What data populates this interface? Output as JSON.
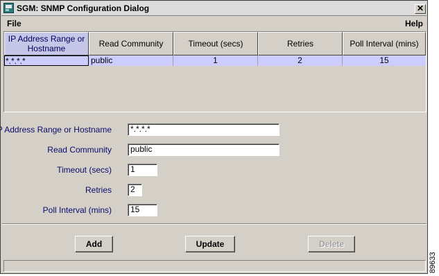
{
  "window": {
    "title": "SGM: SNMP Configuration Dialog",
    "close_glyph": "✕"
  },
  "menu": {
    "file": "File",
    "help": "Help"
  },
  "table": {
    "headers": [
      "IP Address Range or Hostname",
      "Read Community",
      "Timeout (secs)",
      "Retries",
      "Poll Interval (mins)"
    ],
    "rows": [
      {
        "ip": "*.*.*.*",
        "community": "public",
        "timeout": "1",
        "retries": "2",
        "poll": "15"
      }
    ]
  },
  "form": {
    "ip_label": "IP Address Range or Hostname",
    "ip_value": "*.*.*.*",
    "community_label": "Read Community",
    "community_value": "public",
    "timeout_label": "Timeout (secs)",
    "timeout_value": "1",
    "retries_label": "Retries",
    "retries_value": "2",
    "poll_label": "Poll Interval (mins)",
    "poll_value": "15"
  },
  "buttons": {
    "add": "Add",
    "update": "Update",
    "delete": "Delete"
  },
  "figure_number": "89633"
}
